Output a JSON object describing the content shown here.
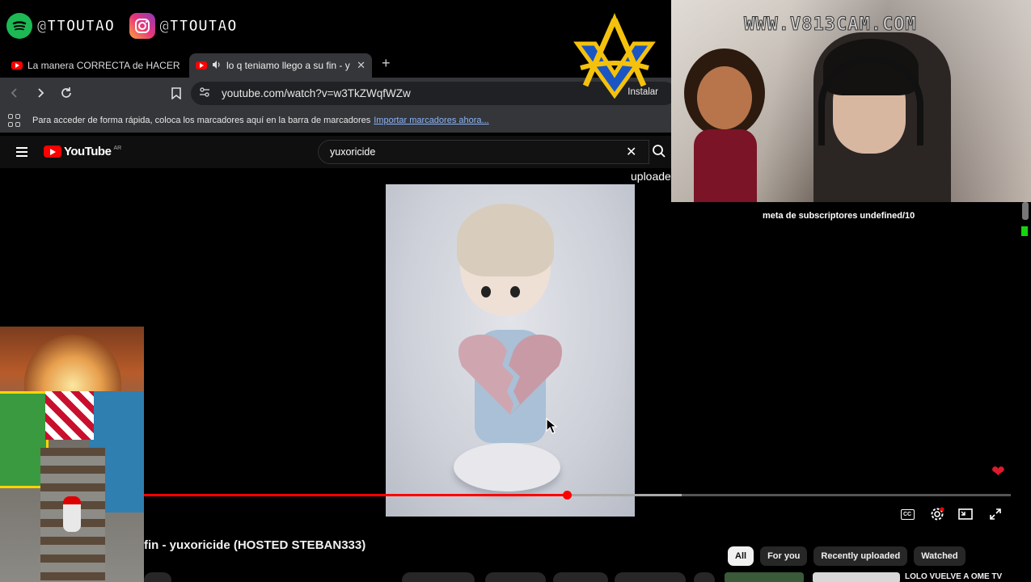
{
  "overlay": {
    "social": [
      {
        "icon": "spotify-icon",
        "handle": "@TTOUTAO"
      },
      {
        "icon": "instagram-icon",
        "handle": "@TTOUTAO"
      }
    ],
    "watermark": "WWW.V813CAM.COM"
  },
  "browser": {
    "tabs": [
      {
        "title": "La manera CORRECTA de HACER un I",
        "active": false
      },
      {
        "title": "lo q teniamo llego a su fin - y",
        "active": true
      }
    ],
    "new_tab": "+",
    "url": "youtube.com/watch?v=w3TkZWqfWZw",
    "install_label": "Instalar",
    "bookmarks_prompt": "Para acceder de forma rápida, coloca los marcadores aquí en la barra de marcadores",
    "bookmarks_link": "Importar marcadores ahora..."
  },
  "youtube": {
    "logo": "YouTube",
    "region": "AR",
    "search_query": "yuxoricide",
    "side_label": "uploade",
    "video_title": "fin - yuxoricide (HOSTED STEBAN333)",
    "chips": [
      {
        "label": "All",
        "active": true
      },
      {
        "label": "For you",
        "active": false
      },
      {
        "label": "Recently uploaded",
        "active": false
      },
      {
        "label": "Watched",
        "active": false
      }
    ],
    "recommended_title": "LOLO VUELVE A OME TV",
    "progress": {
      "played": 0.488,
      "buffered": 0.62
    },
    "controls": {
      "cc": "CC"
    }
  },
  "stream": {
    "subscriber_goal": "meta de subscriptores undefined/10"
  },
  "colors": {
    "accent_red": "#ff0000",
    "heart": "#e0192c",
    "green": "#16d40e"
  }
}
